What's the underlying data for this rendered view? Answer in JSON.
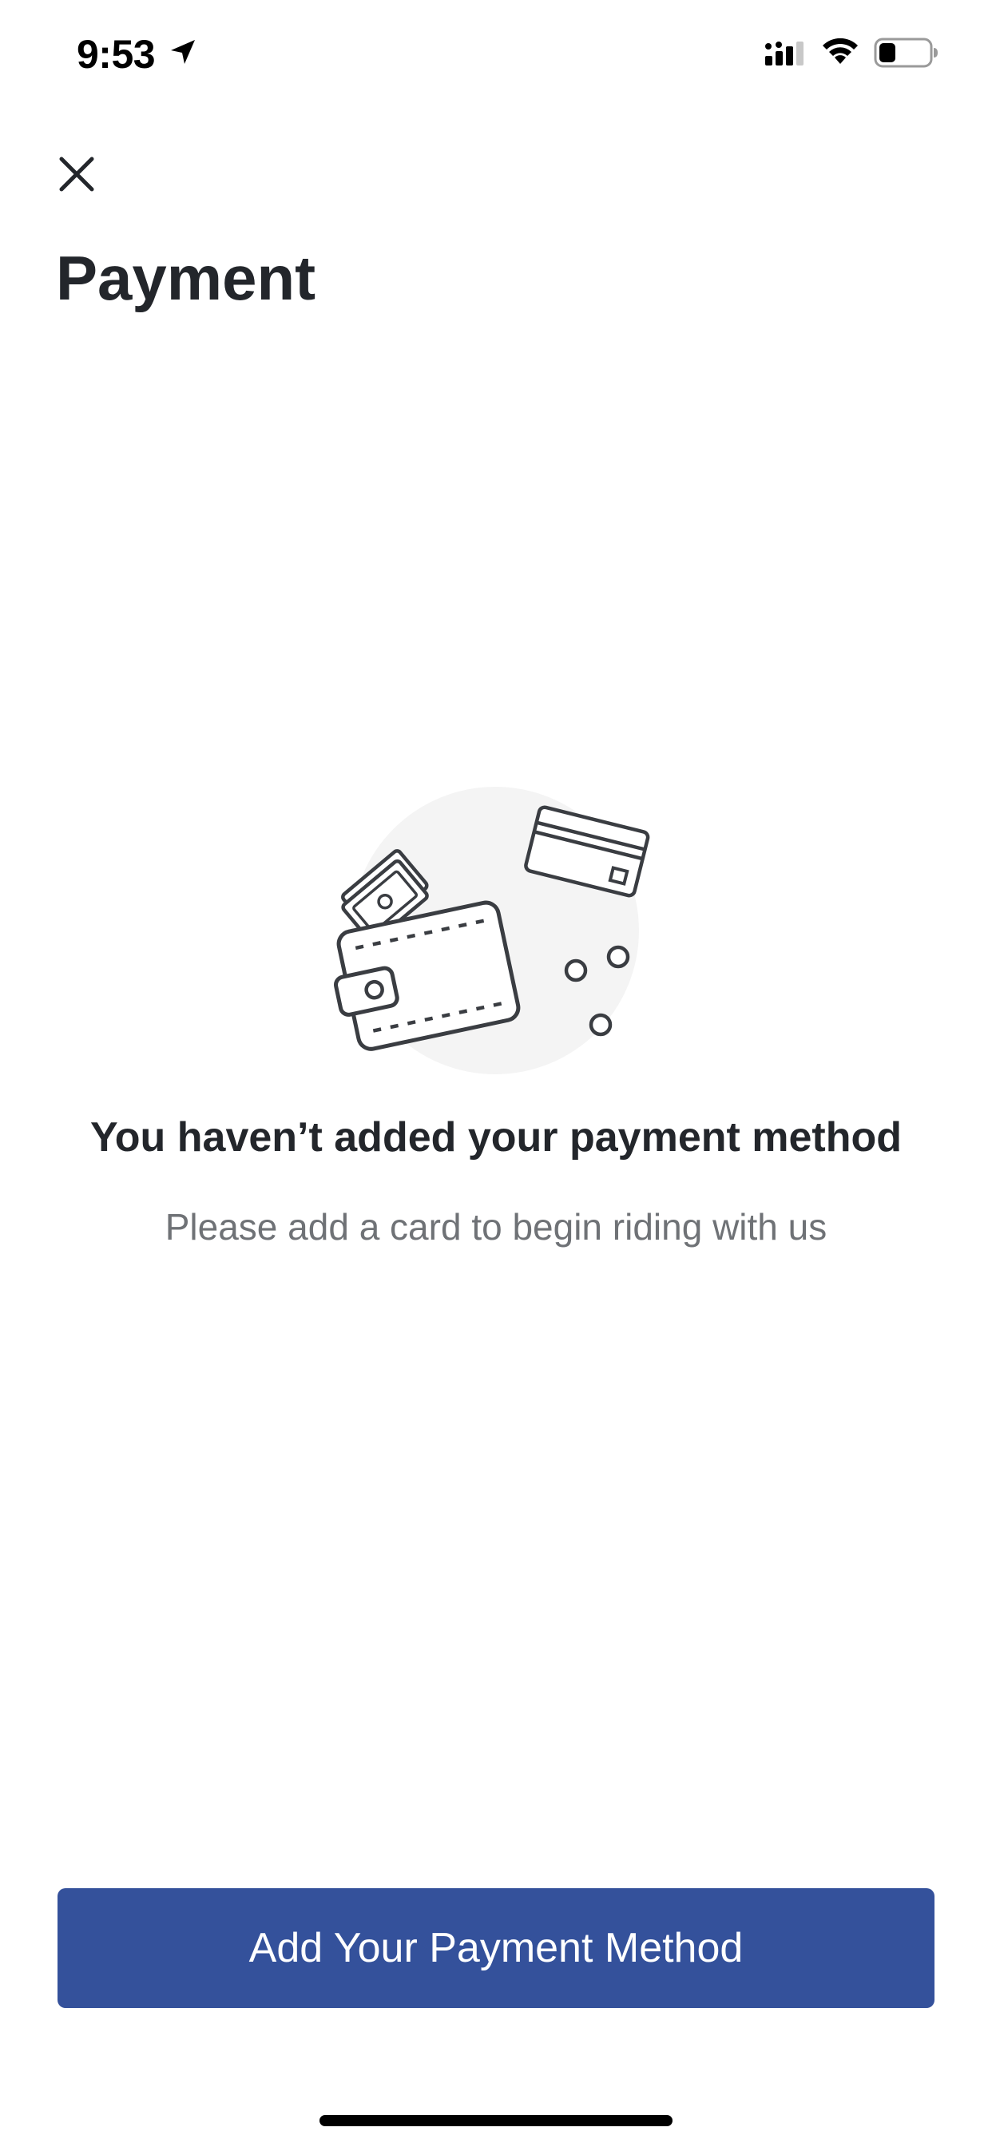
{
  "status_bar": {
    "time": "9:53",
    "icons": [
      "location-arrow-icon",
      "cellular-signal-icon",
      "wifi-icon",
      "battery-icon"
    ]
  },
  "header": {
    "close_icon": "close-icon",
    "title": "Payment"
  },
  "empty_state": {
    "illustration": "wallet-and-card-icon",
    "title": "You haven’t added your payment method",
    "subtitle": "Please add a card to begin riding with us"
  },
  "actions": {
    "primary_label": "Add Your Payment Method"
  },
  "colors": {
    "primary": "#34519b",
    "text_primary": "#23262b",
    "text_secondary": "#6f7276",
    "illustration_bg": "#f4f4f4"
  }
}
